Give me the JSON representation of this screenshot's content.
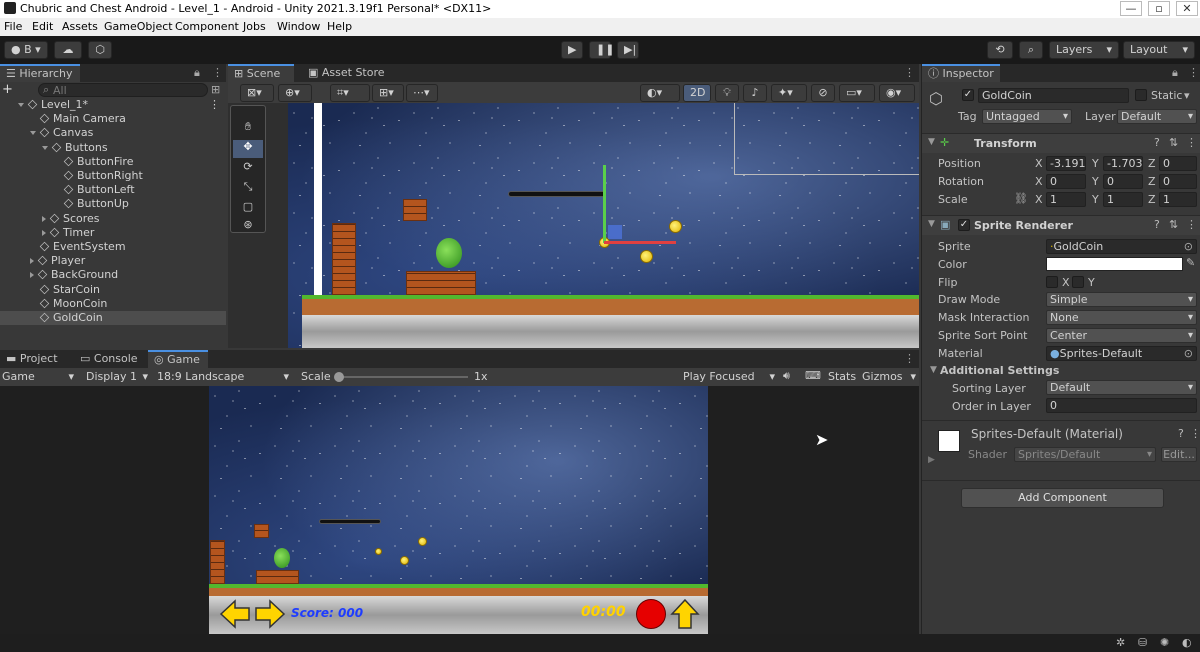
{
  "window": {
    "title": "Chubric and Chest Android - Level_1 - Android - Unity 2021.3.19f1 Personal* <DX11>",
    "controls": [
      "—",
      "▫",
      "✕"
    ]
  },
  "menu": [
    "File",
    "Edit",
    "Assets",
    "GameObject",
    "Component",
    "Jobs",
    "Window",
    "Help"
  ],
  "toolbar": {
    "account_label": "B",
    "layers_label": "Layers",
    "layout_label": "Layout"
  },
  "hierarchy": {
    "tab": "Hierarchy",
    "search_placeholder": "All",
    "add_label": "+",
    "items": [
      {
        "label": "Level_1*",
        "indent": 0
      },
      {
        "label": "Main Camera",
        "indent": 1
      },
      {
        "label": "Canvas",
        "indent": 1
      },
      {
        "label": "Buttons",
        "indent": 2
      },
      {
        "label": "ButtonFire",
        "indent": 3
      },
      {
        "label": "ButtonRight",
        "indent": 3
      },
      {
        "label": "ButtonLeft",
        "indent": 3
      },
      {
        "label": "ButtonUp",
        "indent": 3
      },
      {
        "label": "Scores",
        "indent": 2
      },
      {
        "label": "Timer",
        "indent": 2
      },
      {
        "label": "EventSystem",
        "indent": 1
      },
      {
        "label": "Player",
        "indent": 1
      },
      {
        "label": "BackGround",
        "indent": 1
      },
      {
        "label": "StarCoin",
        "indent": 1
      },
      {
        "label": "MoonCoin",
        "indent": 1
      },
      {
        "label": "GoldCoin",
        "indent": 1
      }
    ]
  },
  "scene": {
    "tabs": [
      "Scene",
      "Asset Store"
    ],
    "mode_2d": "2D"
  },
  "bottom_tabs": [
    "Project",
    "Console",
    "Game"
  ],
  "game_toolbar": {
    "display_type": "Game",
    "display": "Display 1",
    "aspect": "18:9 Landscape",
    "scale_label": "Scale",
    "scale_value": "1x",
    "play_mode": "Play Focused",
    "stats": "Stats",
    "gizmos": "Gizmos"
  },
  "game_hud": {
    "score": "Score: 000",
    "timer": "00:00"
  },
  "inspector": {
    "tab": "Inspector",
    "object_name": "GoldCoin",
    "static_label": "Static",
    "tag_label": "Tag",
    "tag_value": "Untagged",
    "layer_label": "Layer",
    "layer_value": "Default",
    "transform": {
      "title": "Transform",
      "position_label": "Position",
      "rotation_label": "Rotation",
      "scale_label": "Scale",
      "position": {
        "x": "-3.191",
        "y": "-1.703",
        "z": "0"
      },
      "rotation": {
        "x": "0",
        "y": "0",
        "z": "0"
      },
      "scale": {
        "x": "1",
        "y": "1",
        "z": "1"
      }
    },
    "sprite_renderer": {
      "title": "Sprite Renderer",
      "sprite_label": "Sprite",
      "sprite_value": "GoldCoin",
      "color_label": "Color",
      "flip_label": "Flip",
      "flip_x": "X",
      "flip_y": "Y",
      "draw_mode_label": "Draw Mode",
      "draw_mode": "Simple",
      "mask_label": "Mask Interaction",
      "mask_value": "None",
      "sort_point_label": "Sprite Sort Point",
      "sort_point": "Center",
      "material_label": "Material",
      "material_value": "Sprites-Default",
      "additional_label": "Additional Settings",
      "sorting_layer_label": "Sorting Layer",
      "sorting_layer": "Default",
      "order_label": "Order in Layer",
      "order_value": "0"
    },
    "material": {
      "title": "Sprites-Default (Material)",
      "shader_label": "Shader",
      "shader_value": "Sprites/Default",
      "edit_label": "Edit..."
    },
    "add_component": "Add Component"
  },
  "colors": {
    "accent": "#4a90e2",
    "panel": "#383838",
    "hud_text": "#1e3cff",
    "timer_text": "#ffd200",
    "fire_button": "#e60000",
    "arrow_button": "#ffd400"
  }
}
